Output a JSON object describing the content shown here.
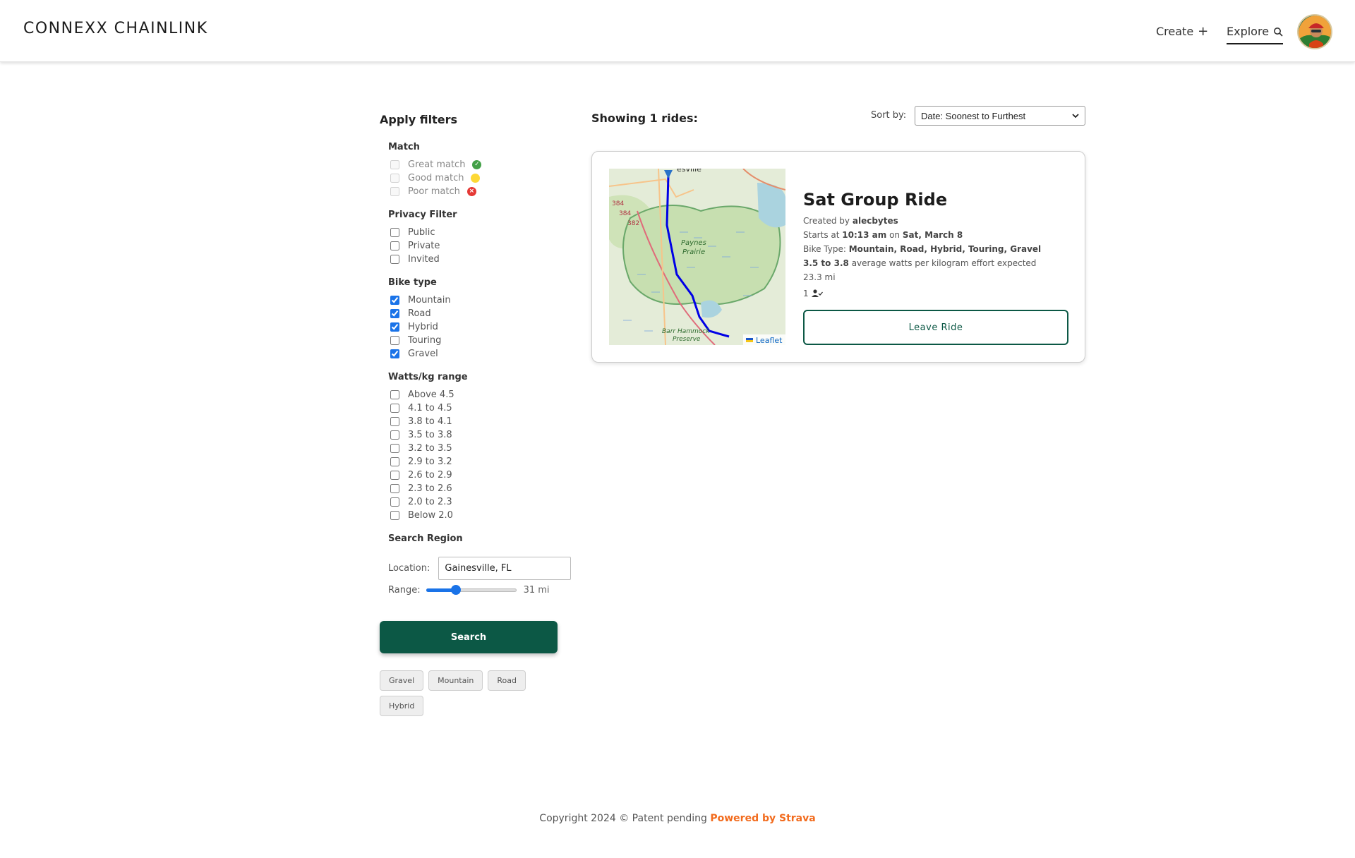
{
  "header": {
    "brand": "CONNEXX CHAINLINK",
    "nav": {
      "create": "Create",
      "explore": "Explore"
    }
  },
  "filters": {
    "title": "Apply filters",
    "match": {
      "title": "Match",
      "items": [
        {
          "label": "Great match",
          "checked": false,
          "status": "green"
        },
        {
          "label": "Good match",
          "checked": false,
          "status": "yellow"
        },
        {
          "label": "Poor match",
          "checked": false,
          "status": "red"
        }
      ]
    },
    "privacy": {
      "title": "Privacy Filter",
      "items": [
        {
          "label": "Public",
          "checked": false
        },
        {
          "label": "Private",
          "checked": false
        },
        {
          "label": "Invited",
          "checked": false
        }
      ]
    },
    "bike_type": {
      "title": "Bike type",
      "items": [
        {
          "label": "Mountain",
          "checked": true
        },
        {
          "label": "Road",
          "checked": true
        },
        {
          "label": "Hybrid",
          "checked": true
        },
        {
          "label": "Touring",
          "checked": false
        },
        {
          "label": "Gravel",
          "checked": true
        }
      ]
    },
    "watts": {
      "title": "Watts/kg range",
      "items": [
        {
          "label": "Above 4.5",
          "checked": false
        },
        {
          "label": "4.1 to 4.5",
          "checked": false
        },
        {
          "label": "3.8 to 4.1",
          "checked": false
        },
        {
          "label": "3.5 to 3.8",
          "checked": false
        },
        {
          "label": "3.2 to 3.5",
          "checked": false
        },
        {
          "label": "2.9 to 3.2",
          "checked": false
        },
        {
          "label": "2.6 to 2.9",
          "checked": false
        },
        {
          "label": "2.3 to 2.6",
          "checked": false
        },
        {
          "label": "2.0 to 2.3",
          "checked": false
        },
        {
          "label": "Below 2.0",
          "checked": false
        }
      ]
    },
    "region": {
      "title": "Search Region",
      "location_label": "Location:",
      "location_value": "Gainesville, FL",
      "range_label": "Range:",
      "range_value": "31 mi",
      "range_fraction": 0.33
    },
    "search_label": "Search",
    "tags": [
      "Gravel",
      "Mountain",
      "Road",
      "Hybrid"
    ]
  },
  "results": {
    "showing": "Showing 1 rides:",
    "sort_label": "Sort by:",
    "sort_value": "Date: Soonest to Furthest"
  },
  "ride": {
    "title": "Sat Group Ride",
    "created_prefix": "Created by",
    "creator": "alecbytes",
    "starts_prefix": "Starts at",
    "time": "10:13 am",
    "on_word": "on",
    "date": "Sat, March 8",
    "bike_type_prefix": "Bike Type:",
    "bike_types": "Mountain, Road, Hybrid, Touring, Gravel",
    "watts_range": "3.5 to 3.8",
    "watts_suffix": "average watts per kilogram effort expected",
    "distance": "23.3 mi",
    "participants": "1",
    "leave_label": "Leave Ride",
    "map": {
      "attribution": "Leaflet",
      "place_top": "esville",
      "place_prairie_1": "Paynes",
      "place_prairie_2": "Prairie",
      "place_bottom_1": "Barr Hammock",
      "place_bottom_2": "Preserve",
      "road_1": "384",
      "road_2": "384",
      "road_3": "382"
    }
  },
  "footer": {
    "copyright": "Copyright 2024 ©  Patent pending",
    "strava": "Powered by Strava"
  },
  "colors": {
    "primary": "#0c5845",
    "strava": "#f26b1d",
    "route": "#0000e6"
  }
}
